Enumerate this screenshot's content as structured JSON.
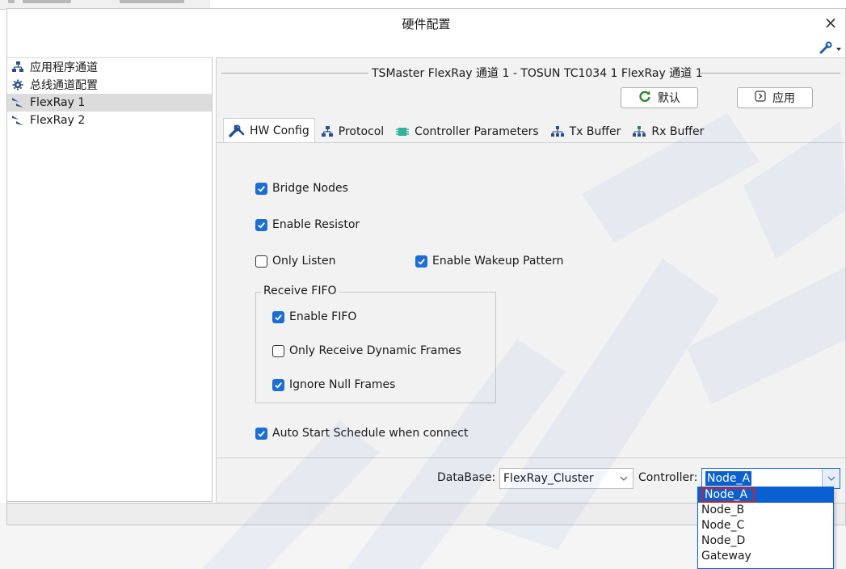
{
  "window": {
    "title": "硬件配置",
    "close_glyph": "×"
  },
  "tree": {
    "items": [
      {
        "label": "应用程序通道",
        "icon": "network-icon"
      },
      {
        "label": "总线通道配置",
        "icon": "gear-icon"
      },
      {
        "label": "FlexRay 1",
        "icon": "flexray-icon",
        "selected": true
      },
      {
        "label": "FlexRay 2",
        "icon": "flexray-icon"
      }
    ]
  },
  "panel": {
    "header": "TSMaster FlexRay 通道 1 - TOSUN TC1034 1 FlexRay 通道 1",
    "default_button": "默认",
    "apply_button": "应用"
  },
  "tabs": [
    {
      "label": "HW Config",
      "icon": "tools-icon",
      "active": true
    },
    {
      "label": "Protocol",
      "icon": "network-icon"
    },
    {
      "label": "Controller Parameters",
      "icon": "chip-icon"
    },
    {
      "label": "Tx Buffer",
      "icon": "buffer-icon"
    },
    {
      "label": "Rx Buffer",
      "icon": "buffer-icon"
    }
  ],
  "hw_config": {
    "bridge_nodes": {
      "label": "Bridge Nodes",
      "checked": true
    },
    "enable_resistor": {
      "label": "Enable Resistor",
      "checked": true
    },
    "only_listen": {
      "label": "Only Listen",
      "checked": false
    },
    "enable_wakeup": {
      "label": "Enable Wakeup Pattern",
      "checked": true
    },
    "receive_fifo": {
      "legend": "Receive FIFO",
      "enable_fifo": {
        "label": "Enable FIFO",
        "checked": true
      },
      "only_dynamic": {
        "label": "Only Receive Dynamic Frames",
        "checked": false
      },
      "ignore_null": {
        "label": "Ignore Null Frames",
        "checked": true
      }
    },
    "auto_start": {
      "label": "Auto Start Schedule when connect",
      "checked": true
    }
  },
  "bottom": {
    "database_label": "DataBase:",
    "database_value": "FlexRay_Cluster",
    "controller_label": "Controller:",
    "controller_value": "Node_A",
    "controller_options": [
      "Node_A",
      "Node_B",
      "Node_C",
      "Node_D",
      "Gateway"
    ]
  },
  "colors": {
    "accent": "#1c6ed5",
    "selection": "#0a5fd1",
    "highlight_border": "#d0202a"
  }
}
